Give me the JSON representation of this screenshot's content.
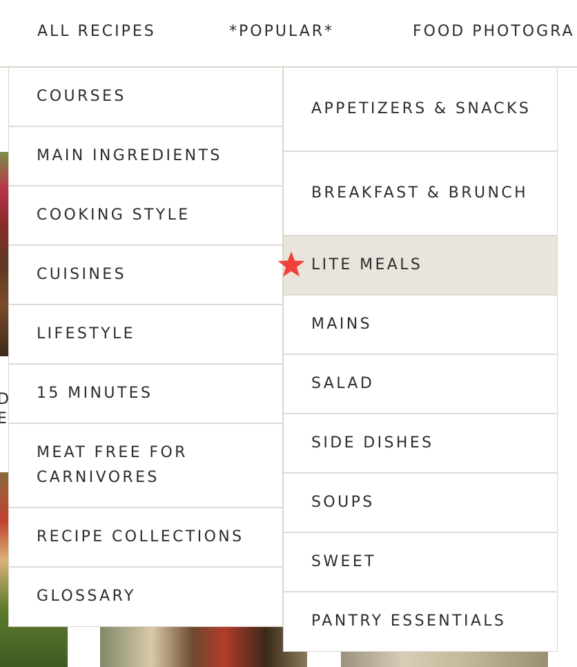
{
  "nav": {
    "items": [
      {
        "label": "ALL RECIPES"
      },
      {
        "label": "*POPULAR*"
      },
      {
        "label": "FOOD PHOTOGRA"
      }
    ]
  },
  "dropdown": {
    "left_items": [
      {
        "label": "COURSES"
      },
      {
        "label": "MAIN INGREDIENTS"
      },
      {
        "label": "COOKING STYLE"
      },
      {
        "label": "CUISINES"
      },
      {
        "label": "LIFESTYLE"
      },
      {
        "label": "15 MINUTES"
      },
      {
        "label": "MEAT FREE FOR CARNIVORES"
      },
      {
        "label": "RECIPE COLLECTIONS"
      },
      {
        "label": "GLOSSARY"
      }
    ],
    "right_items": [
      {
        "label": "APPETIZERS & SNACKS"
      },
      {
        "label": "BREAKFAST & BRUNCH"
      },
      {
        "label": "LITE MEALS"
      },
      {
        "label": "MAINS"
      },
      {
        "label": "SALAD"
      },
      {
        "label": "SIDE DISHES"
      },
      {
        "label": "SOUPS"
      },
      {
        "label": "SWEET"
      },
      {
        "label": "PANTRY ESSENTIALS"
      }
    ],
    "active_item": "LITE MEALS"
  },
  "background": {
    "fragments": [
      "D",
      "ES"
    ]
  },
  "colors": {
    "text": "#2b2b2b",
    "divider": "#dedad2",
    "active_bg": "#e9e5dc",
    "marker": "#f0413a"
  },
  "icons": {
    "marker": "star-icon"
  }
}
